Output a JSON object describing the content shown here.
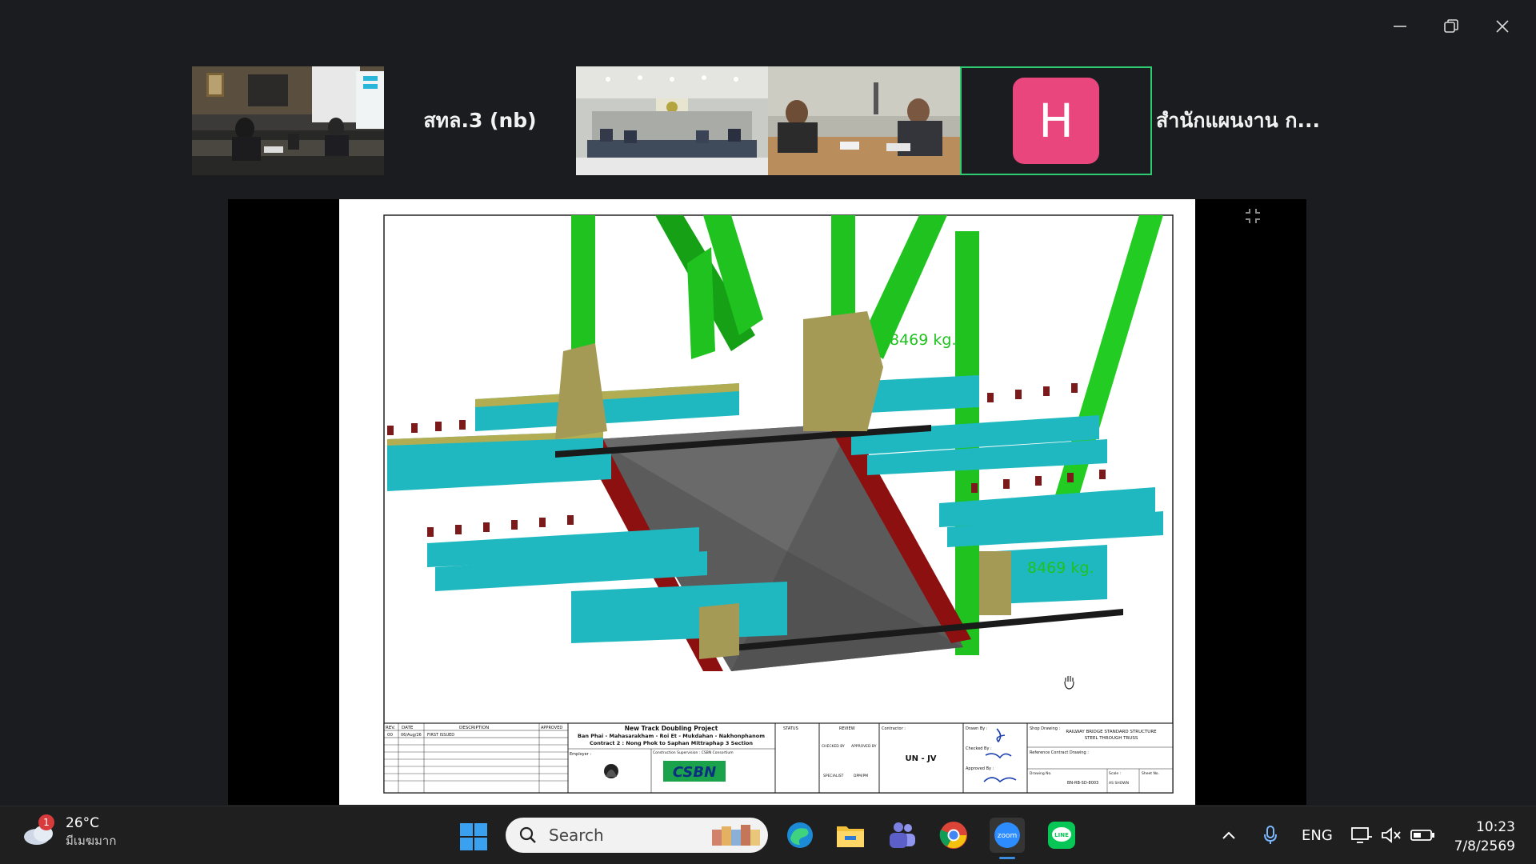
{
  "window": {
    "controls": [
      "minimize",
      "restore",
      "close"
    ]
  },
  "gallery": {
    "participant_1_name": "สทล.3 (nb)",
    "participant_2_initial": "H",
    "participant_2_name": "สำนักแผนงาน ก...",
    "colors": {
      "active_speaker_border": "#2ecc71",
      "avatar_bg": "#e8467c"
    }
  },
  "drawing": {
    "weight_label_1": "8469 kg.",
    "weight_label_2": "8469 kg.",
    "title_block": {
      "rev_header": "REV.",
      "date_header": "DATE",
      "description_header": "DESCRIPTION",
      "approved_header": "APPROVED",
      "rev_value": "00",
      "date_value": "06/Aug/26",
      "description_value": "FIRST ISSUED",
      "project_line_1": "New Track Doubling Project",
      "project_line_2": "Ban Phai - Mahasarakham - Roi Et - Mukdahan - Nakhonphanom",
      "project_line_3": "Contract 2 : Nong Phok to Saphan Mittraphap 3 Section",
      "employer_label": "Employer :",
      "supervision_label": "Construction Supervision : CSBN Consortium",
      "supervision_logo": "CSBN",
      "status_header": "STATUS",
      "review_header": "REVIEW",
      "checked_by_label": "CHECKED BY",
      "approved_by_label": "APPROVED BY",
      "specialist_label": "SPECIALIST",
      "dpm_label": "DPM/PM",
      "contractor_label": "Contractor :",
      "contractor_value": "UN - JV",
      "drawn_by_label": "Drawn By :",
      "checked_label": "Checked By :",
      "approved_label": "Approved By :",
      "shop_drawing_label": "Shop Drawing :",
      "drawing_title_1": "RAILWAY BRIDGE STANDARD STRUCTURE",
      "drawing_title_2": "STEEL THROUGH TRUSS",
      "reference_label": "Reference Contract Drawing :",
      "drawing_no_label": "Drawing No.",
      "drawing_no_value": "BN-RB-SD-8003",
      "scale_label": "Scale :",
      "scale_value": "AS SHOWN",
      "sheet_label": "Sheet No."
    },
    "colors": {
      "truss_green": "#1fc21f",
      "beam_cyan": "#1fb8c0",
      "flange_olive": "#a49a55",
      "stringer_red": "#8c1010",
      "deck_gray": "#5b5b5b"
    }
  },
  "taskbar": {
    "weather_badge": "1",
    "weather_temp": "26°C",
    "weather_condition": "มีเมฆมาก",
    "search_placeholder": "Search",
    "language": "ENG",
    "time": "10:23",
    "date": "7/8/2569",
    "apps": [
      "edge-icon",
      "file-explorer-icon",
      "teams-icon",
      "chrome-icon",
      "zoom-icon",
      "line-icon"
    ]
  }
}
